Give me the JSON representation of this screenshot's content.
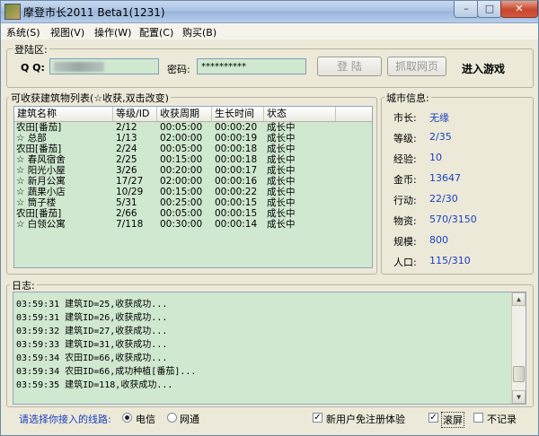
{
  "window": {
    "title": "摩登市长2011 Beta1(1231)"
  },
  "menu": [
    {
      "label": "系统(S)"
    },
    {
      "label": "视图(V)"
    },
    {
      "label": "操作(W)"
    },
    {
      "label": "配置(C)"
    },
    {
      "label": "购买(B)"
    }
  ],
  "login": {
    "legend": "登陆区:",
    "qq_label": "Q Q:",
    "password_label": "密码:",
    "password_value": "**********",
    "login_button": "登 陆",
    "grab_button": "抓取网页",
    "enter_game": "进入游戏"
  },
  "buildings": {
    "legend": "可收获建筑物列表(☆收获,双击改变)",
    "columns": [
      "建筑名称",
      "等级/ID",
      "收获周期",
      "生长时间",
      "状态"
    ],
    "rows": [
      [
        "农田[番茄]",
        "2/12",
        "00:05:00",
        "00:00:20",
        "成长中"
      ],
      [
        "☆ 总部",
        "1/13",
        "02:00:00",
        "00:00:19",
        "成长中"
      ],
      [
        "农田[番茄]",
        "2/24",
        "00:05:00",
        "00:00:18",
        "成长中"
      ],
      [
        "☆ 春风宿舍",
        "2/25",
        "00:15:00",
        "00:00:18",
        "成长中"
      ],
      [
        "☆ 阳光小屋",
        "3/26",
        "00:20:00",
        "00:00:17",
        "成长中"
      ],
      [
        "☆ 新月公寓",
        "17/27",
        "02:00:00",
        "00:00:16",
        "成长中"
      ],
      [
        "☆ 蔬果小店",
        "10/29",
        "00:15:00",
        "00:00:22",
        "成长中"
      ],
      [
        "☆ 筒子楼",
        "5/31",
        "00:25:00",
        "00:00:15",
        "成长中"
      ],
      [
        "农田[番茄]",
        "2/66",
        "00:05:00",
        "00:00:15",
        "成长中"
      ],
      [
        "☆ 白领公寓",
        "7/118",
        "00:30:00",
        "00:00:14",
        "成长中"
      ]
    ]
  },
  "city": {
    "legend": "城市信息:",
    "items": [
      {
        "label": "市长:",
        "value": "无缘"
      },
      {
        "label": "等级:",
        "value": "2/35"
      },
      {
        "label": "经验:",
        "value": "10"
      },
      {
        "label": "金币:",
        "value": "13647"
      },
      {
        "label": "行动:",
        "value": "22/30"
      },
      {
        "label": "物资:",
        "value": "570/3150"
      },
      {
        "label": "规模:",
        "value": "800"
      },
      {
        "label": "人口:",
        "value": "115/310"
      }
    ]
  },
  "log": {
    "legend": "日志:",
    "lines": [
      "03:59:31 建筑ID=25,收获成功...",
      "03:59:31 建筑ID=26,收获成功...",
      "03:59:32 建筑ID=27,收获成功...",
      "03:59:33 建筑ID=31,收获成功...",
      "03:59:34 农田ID=66,收获成功...",
      "03:59:34 农田ID=66,成功种植[番茄]...",
      "03:59:35 建筑ID=118,收获成功..."
    ]
  },
  "footer": {
    "line_prompt": "请选择你接入的线路:",
    "radio_telecom": "电信",
    "radio_netcom": "网通",
    "check_newuser": "新用户免注册体验",
    "check_scroll": "滚屏",
    "check_nolog": "不记录",
    "prompt_color": "#1a3fc0"
  }
}
